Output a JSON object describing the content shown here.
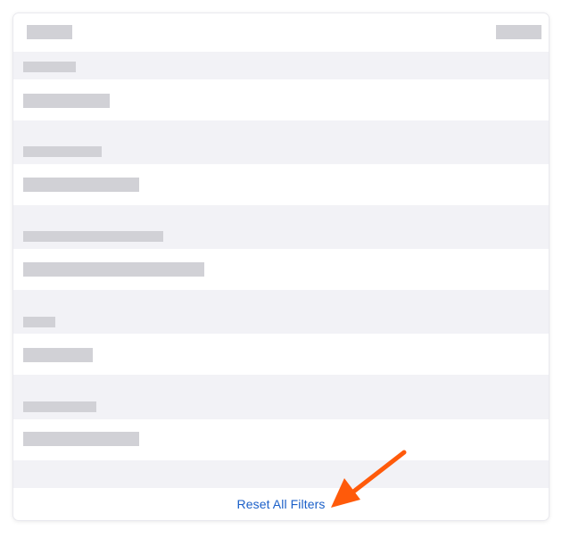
{
  "footer": {
    "reset_label": "Reset All Filters"
  },
  "colors": {
    "background": "#f2f2f6",
    "row": "#ffffff",
    "placeholder": "#d1d1d6",
    "link": "#1a5fc8",
    "annotation_arrow": "#ff5a0a"
  },
  "icons": {
    "annotation": "arrow-icon"
  }
}
